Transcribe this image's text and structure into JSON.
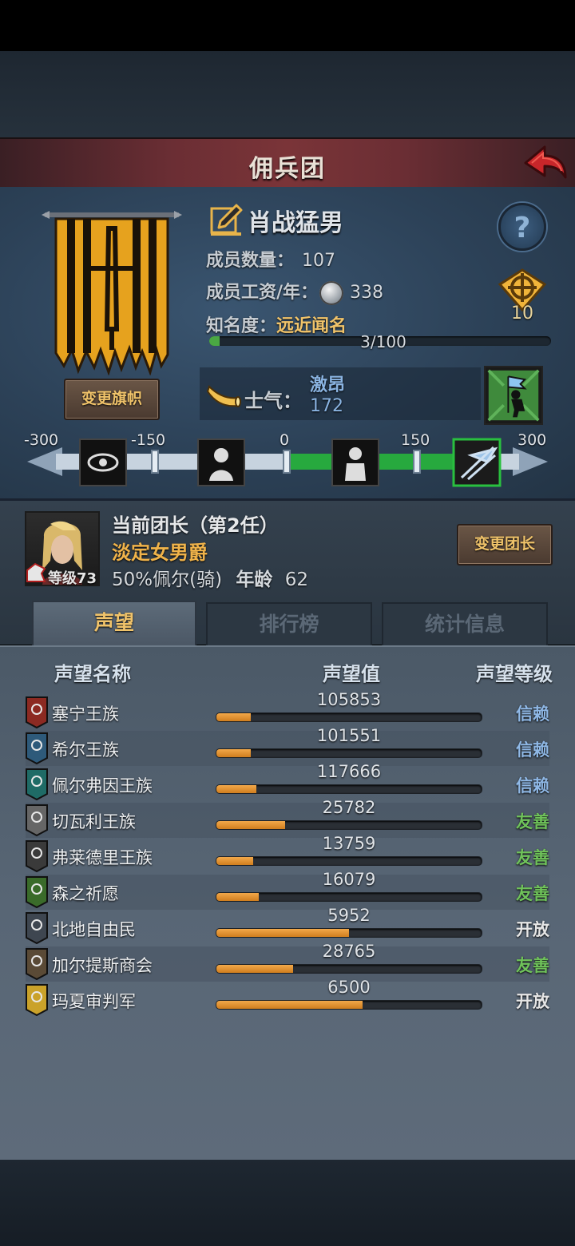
{
  "title": "佣兵团",
  "company": {
    "name": "肖战猛男",
    "members_label": "成员数量：",
    "members": "107",
    "wage_label": "成员工资/年：",
    "wage": "338",
    "fame_label": "知名度：",
    "fame_level": "远近闻名",
    "fame_progress": "3/100",
    "fame_fraction": 0.03,
    "target_count": "10",
    "change_banner": "变更旗帜"
  },
  "morale": {
    "label": "士气：",
    "state": "激昂",
    "value": "172",
    "scale": [
      "-300",
      "-150",
      "0",
      "150",
      "300"
    ],
    "fill_from": 0,
    "fill_to": 172
  },
  "leader": {
    "title": "当前团长（第2任）",
    "name": "淡定女男爵",
    "level_label": "等级73",
    "info": "50%佩尔(骑)",
    "age_label": "年龄",
    "age": "62",
    "change_button": "变更团长"
  },
  "tabs": [
    {
      "label": "声望",
      "active": true
    },
    {
      "label": "排行榜",
      "active": false
    },
    {
      "label": "统计信息",
      "active": false
    }
  ],
  "table": {
    "headers": [
      "声望名称",
      "声望值",
      "声望等级"
    ],
    "rows": [
      {
        "name": "塞宁王族",
        "value": "105853",
        "level": "信赖",
        "fill": 0.13,
        "level_color": "#8fb8e6",
        "icon_color": "#8c2a22"
      },
      {
        "name": "希尔王族",
        "value": "101551",
        "level": "信赖",
        "fill": 0.13,
        "level_color": "#8fb8e6",
        "icon_color": "#2e5a7a"
      },
      {
        "name": "佩尔弗因王族",
        "value": "117666",
        "level": "信赖",
        "fill": 0.15,
        "level_color": "#8fb8e6",
        "icon_color": "#1f6b66"
      },
      {
        "name": "切瓦利王族",
        "value": "25782",
        "level": "友善",
        "fill": 0.26,
        "level_color": "#6fc25a",
        "icon_color": "#666666"
      },
      {
        "name": "弗莱德里王族",
        "value": "13759",
        "level": "友善",
        "fill": 0.14,
        "level_color": "#6fc25a",
        "icon_color": "#3a3a3a"
      },
      {
        "name": "森之祈愿",
        "value": "16079",
        "level": "友善",
        "fill": 0.16,
        "level_color": "#6fc25a",
        "icon_color": "#3a6b2a"
      },
      {
        "name": "北地自由民",
        "value": "5952",
        "level": "开放",
        "fill": 0.5,
        "level_color": "#e6e6e6",
        "icon_color": "#3e4650"
      },
      {
        "name": "加尔提斯商会",
        "value": "28765",
        "level": "友善",
        "fill": 0.29,
        "level_color": "#6fc25a",
        "icon_color": "#5a4a36"
      },
      {
        "name": "玛夏审判军",
        "value": "6500",
        "level": "开放",
        "fill": 0.55,
        "level_color": "#e6e6e6",
        "icon_color": "#caa22a"
      }
    ]
  }
}
